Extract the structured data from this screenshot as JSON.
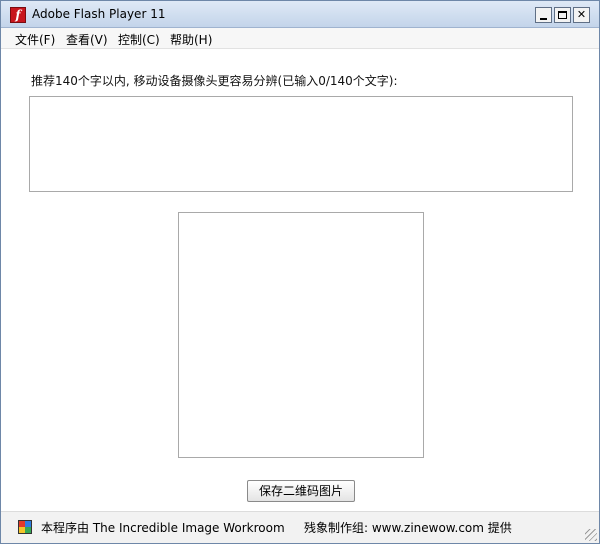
{
  "window": {
    "title": "Adobe Flash Player 11",
    "icon": "flash-icon",
    "controls": {
      "minimize": "minimize-icon",
      "maximize": "maximize-icon",
      "close_glyph": "✕"
    }
  },
  "menu": {
    "items": [
      {
        "label": "文件(F)"
      },
      {
        "label": "查看(V)"
      },
      {
        "label": "控制(C)"
      },
      {
        "label": "帮助(H)"
      }
    ]
  },
  "main": {
    "hint": "推荐140个字以内, 移动设备摄像头更容易分辨(已输入0/140个文字):",
    "text_value": "",
    "save_button_label": "保存二维码图片"
  },
  "status": {
    "credit": "本程序由 The Incredible Image Workroom",
    "provider": "残象制作组: www.zinewow.com 提供"
  },
  "colors": {
    "titlebar": "#c3d4ea",
    "flash_red": "#c8161d",
    "border": "#a9a9a9"
  }
}
